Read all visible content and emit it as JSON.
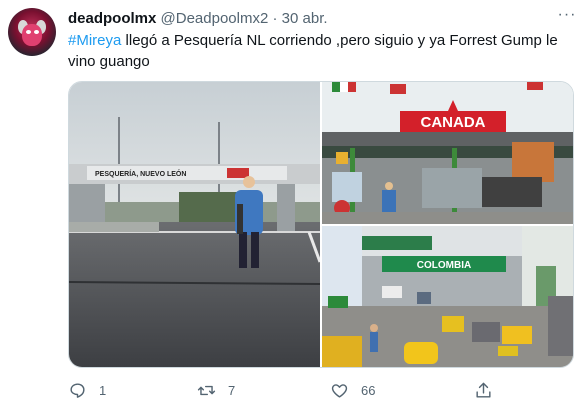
{
  "tweet": {
    "author_name": "deadpoolmx",
    "author_handle": "@Deadpoolmx2",
    "separator": "·",
    "date": "30 abr.",
    "hashtag": "#Mireya",
    "text": " llegó a Pesquería NL corriendo ,pero siguio y ya Forrest Gump le vino guango"
  },
  "media": {
    "left_sign": "PESQUERÍA, NUEVO LEÓN",
    "top_right_sign": "CANADA",
    "bottom_right_sign": "COLOMBIA"
  },
  "actions": {
    "reply_count": "1",
    "retweet_count": "7",
    "like_count": "66"
  },
  "icons": [
    "more-icon",
    "reply-icon",
    "retweet-icon",
    "like-icon",
    "share-icon"
  ],
  "colors": {
    "link": "#1d9bf0",
    "muted": "#536471",
    "text": "#0f1419"
  }
}
